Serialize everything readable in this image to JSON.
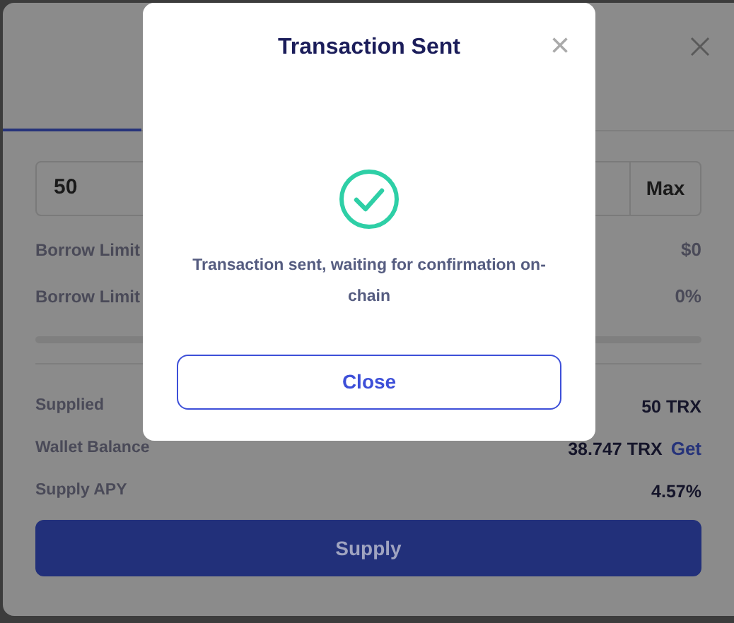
{
  "supply_panel": {
    "amount_field": {
      "value": "50",
      "max_button": "Max"
    },
    "limits": [
      {
        "label": "Borrow Limit",
        "value": "$0"
      },
      {
        "label": "Borrow Limit",
        "value": "0%"
      }
    ],
    "details": [
      {
        "label": "Supplied",
        "value": "50 TRX"
      },
      {
        "label": "Wallet Balance",
        "value": "38.747 TRX",
        "link": "Get"
      },
      {
        "label": "Supply APY",
        "value": "4.57%"
      }
    ],
    "supply_button": "Supply"
  },
  "dialog": {
    "title": "Transaction Sent",
    "close_icon": "×",
    "message": "Transaction sent, waiting for confirmation on-chain",
    "button": "Close"
  }
}
